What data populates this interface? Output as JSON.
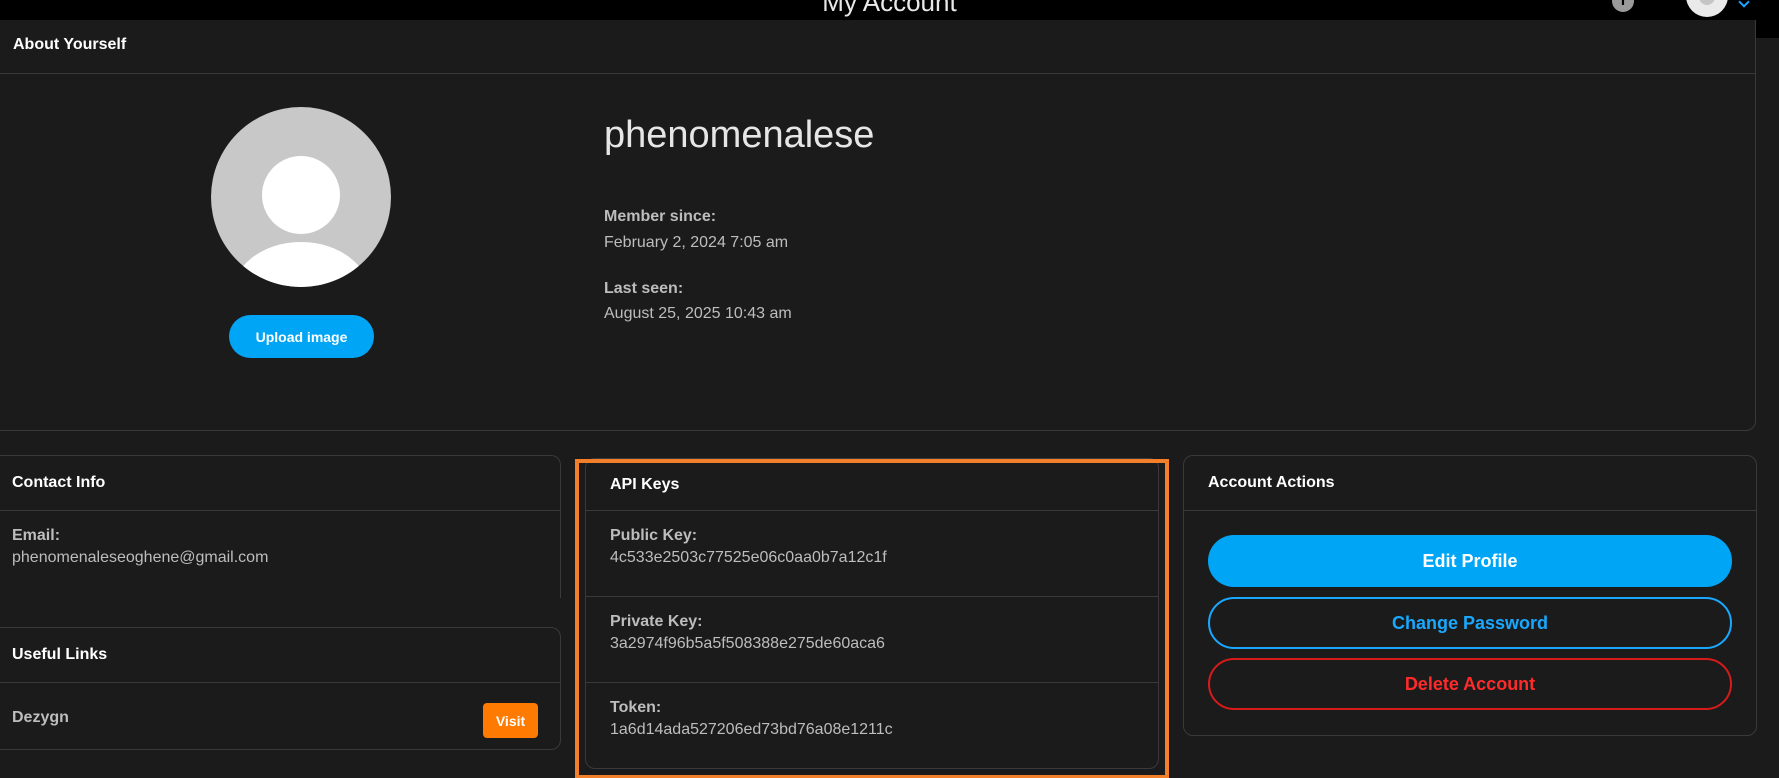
{
  "header": {
    "title": "My Account",
    "help_icon": "info-icon",
    "user_menu_icon": "chevron-down-icon"
  },
  "about": {
    "section_title": "About Yourself",
    "upload_label": "Upload image",
    "username": "phenomenalese",
    "member_since_label": "Member since:",
    "member_since_value": "February 2, 2024 7:05 am",
    "last_seen_label": "Last seen:",
    "last_seen_value": "August 25, 2025 10:43 am"
  },
  "contact": {
    "title": "Contact Info",
    "email_label": "Email:",
    "email_value": "phenomenaleseoghene@gmail.com"
  },
  "links": {
    "title": "Useful Links",
    "items": [
      {
        "name": "Dezygn",
        "button_label": "Visit"
      }
    ]
  },
  "api": {
    "title": "API Keys",
    "public_key_label": "Public Key:",
    "public_key_value": "4c533e2503c77525e06c0aa0b7a12c1f",
    "private_key_label": "Private Key:",
    "private_key_value": "3a2974f96b5a5f508388e275de60aca6",
    "token_label": "Token:",
    "token_value": "1a6d14ada527206ed73bd76a08e1211c"
  },
  "actions": {
    "title": "Account Actions",
    "edit_label": "Edit Profile",
    "change_password_label": "Change Password",
    "delete_label": "Delete Account"
  },
  "colors": {
    "accent": "#00a6f5",
    "danger": "#ff2a2a",
    "visit": "#ff7a00",
    "highlight": "#f47f2a"
  }
}
